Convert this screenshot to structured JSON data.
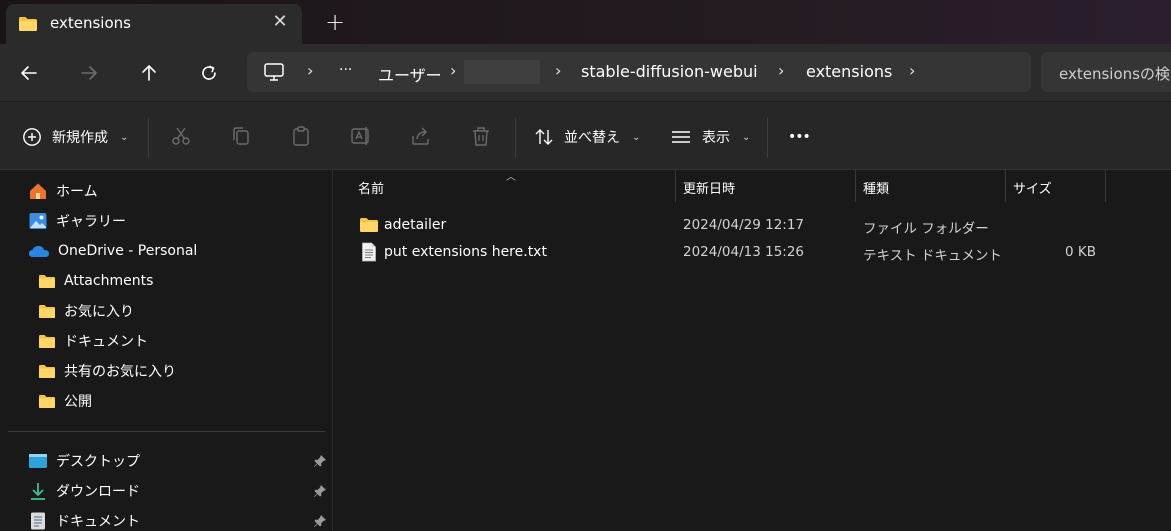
{
  "tab": {
    "title": "extensions",
    "close": "✕",
    "new_tab": "+"
  },
  "address": {
    "ellipsis": "···",
    "crumbs": [
      "ユーザー",
      "stable-diffusion-webui",
      "extensions"
    ],
    "sep": "›"
  },
  "search": {
    "placeholder": "extensionsの検索"
  },
  "commands": {
    "new": "新規作成",
    "sort": "並べ替え",
    "view": "表示",
    "more": "•••"
  },
  "sidebar": {
    "quick": [
      {
        "label": "ホーム"
      },
      {
        "label": "ギャラリー"
      },
      {
        "label": "OneDrive - Personal"
      }
    ],
    "onedrive_children": [
      {
        "label": "Attachments"
      },
      {
        "label": "お気に入り"
      },
      {
        "label": "ドキュメント"
      },
      {
        "label": "共有のお気に入り"
      },
      {
        "label": "公開"
      }
    ],
    "pinned": [
      {
        "label": "デスクトップ"
      },
      {
        "label": "ダウンロード"
      },
      {
        "label": "ドキュメント"
      }
    ]
  },
  "columns": [
    "名前",
    "更新日時",
    "種類",
    "サイズ"
  ],
  "files": [
    {
      "name": "adetailer",
      "modified": "2024/04/29 12:17",
      "type": "ファイル フォルダー",
      "size": "",
      "icon": "folder-icon"
    },
    {
      "name": "put extensions here.txt",
      "modified": "2024/04/13 15:26",
      "type": "テキスト ドキュメント",
      "size": "0 KB",
      "icon": "text-file-icon"
    }
  ],
  "colors": {
    "folder": "#f4c347",
    "accent": "#4aa6e8"
  }
}
